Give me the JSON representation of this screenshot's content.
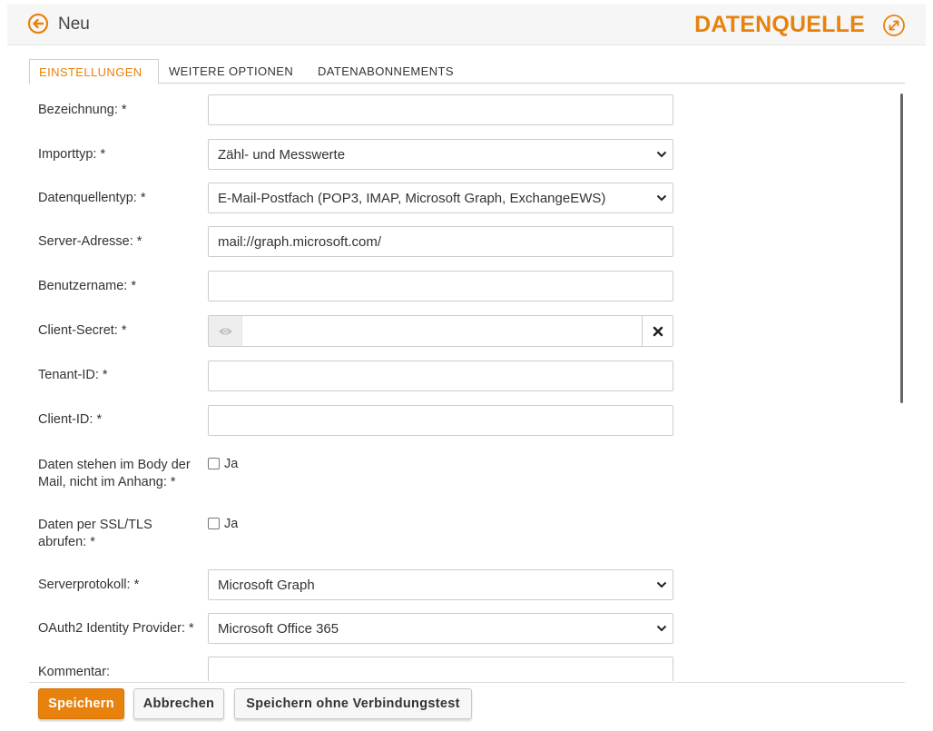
{
  "header": {
    "back_icon": "arrow-left-circle-icon",
    "title": "Neu",
    "brand": "DATENQUELLE",
    "expand_icon": "expand-arrows-icon",
    "accent_color": "#e8820c"
  },
  "tabs": [
    {
      "label": "EINSTELLUNGEN",
      "active": true
    },
    {
      "label": "WEITERE OPTIONEN",
      "active": false
    },
    {
      "label": "DATENABONNEMENTS",
      "active": false
    }
  ],
  "form": {
    "bezeichnung": {
      "label": "Bezeichnung: *",
      "value": ""
    },
    "importtyp": {
      "label": "Importtyp: *",
      "value": "Zähl- und Messwerte"
    },
    "datenquellentyp": {
      "label": "Datenquellentyp: *",
      "value": "E-Mail-Postfach (POP3, IMAP, Microsoft Graph, ExchangeEWS)"
    },
    "server_adresse": {
      "label": "Server-Adresse: *",
      "value": "mail://graph.microsoft.com/"
    },
    "benutzername": {
      "label": "Benutzername: *",
      "value": ""
    },
    "client_secret": {
      "label": "Client-Secret: *",
      "value": "",
      "eye_icon": "eye-icon",
      "clear_icon": "close-icon"
    },
    "tenant_id": {
      "label": "Tenant-ID: *",
      "value": ""
    },
    "client_id": {
      "label": "Client-ID: *",
      "value": ""
    },
    "body_mail": {
      "label_line1": "Daten stehen im Body der",
      "label_line2": "Mail, nicht im Anhang: *",
      "option": "Ja",
      "checked": false
    },
    "ssl_tls": {
      "label_line1": "Daten per SSL/TLS",
      "label_line2": "abrufen: *",
      "option": "Ja",
      "checked": false
    },
    "serverprotokoll": {
      "label": "Serverprotokoll: *",
      "value": "Microsoft Graph"
    },
    "oauth_provider": {
      "label": "OAuth2 Identity Provider: *",
      "value": "Microsoft Office 365"
    },
    "kommentar": {
      "label": "Kommentar:",
      "value": ""
    }
  },
  "footer": {
    "save": "Speichern",
    "cancel": "Abbrechen",
    "save_no_test": "Speichern ohne Verbindungstest"
  }
}
